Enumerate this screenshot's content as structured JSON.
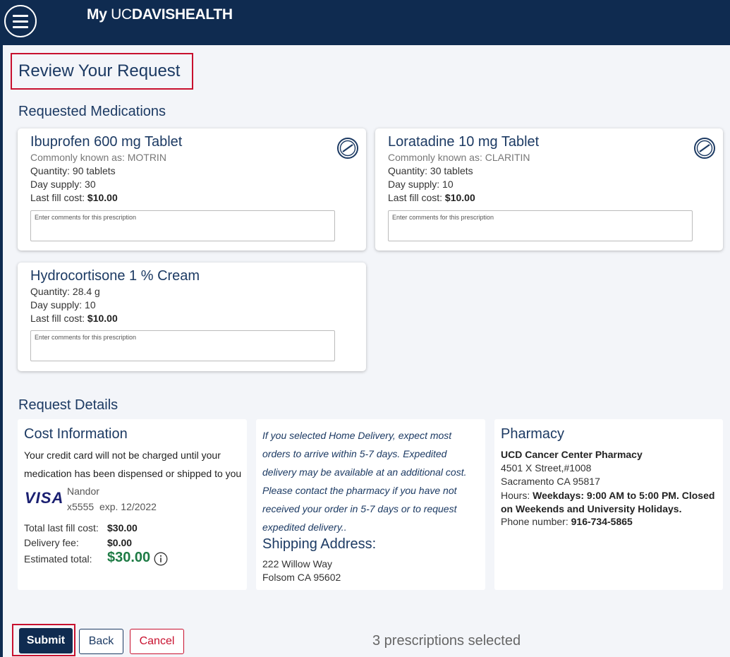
{
  "header": {
    "logo_part1": "My ",
    "logo_part2": "UC",
    "logo_part3": "DAVIS",
    "logo_part4": "HEALTH",
    "menu_icon": "hamburger-icon"
  },
  "page": {
    "title": "Review Your Request"
  },
  "medications_section": {
    "heading": "Requested Medications",
    "comment_placeholder": "Enter comments for this prescription",
    "items": [
      {
        "name": "Ibuprofen 600 mg Tablet",
        "known_as": "Commonly known as: MOTRIN",
        "quantity": "Quantity: 90 tablets",
        "day_supply": "Day supply: 30",
        "last_fill_label": "Last fill cost: ",
        "last_fill_value": "$10.00",
        "icon": "pill-icon"
      },
      {
        "name": "Loratadine 10 mg Tablet",
        "known_as": "Commonly known as: CLARITIN",
        "quantity": "Quantity: 30 tablets",
        "day_supply": "Day supply: 10",
        "last_fill_label": "Last fill cost: ",
        "last_fill_value": "$10.00",
        "icon": "pill-icon"
      },
      {
        "name": "Hydrocortisone 1 % Cream",
        "quantity": "Quantity: 28.4 g",
        "day_supply": "Day supply: 10",
        "last_fill_label": "Last fill cost: ",
        "last_fill_value": "$10.00"
      }
    ]
  },
  "request_details": {
    "heading": "Request Details",
    "cost": {
      "title": "Cost Information",
      "note": "Your credit card will not be charged until your medication has been dispensed or shipped to you",
      "card_brand": "VISA",
      "card_holder": "Nandor",
      "card_number": "x5555",
      "card_exp": "exp. 12/2022",
      "total_last_fill_label": "Total last fill cost:",
      "total_last_fill_value": "$30.00",
      "delivery_fee_label": "Delivery fee:",
      "delivery_fee_value": "$0.00",
      "estimated_total_label": "Estimated total:",
      "estimated_total_value": "$30.00",
      "info_icon": "info-icon"
    },
    "delivery": {
      "note": "If you selected Home Delivery, expect most orders to arrive within 5-7 days. Expedited delivery may be available at an additional cost. Please contact the pharmacy if you have not received your order in 5-7 days or to request expedited delivery..",
      "shipping_title": "Shipping Address:",
      "address_line1": "222 Willow Way",
      "address_line2": "Folsom CA 95602"
    },
    "pharmacy": {
      "title": "Pharmacy",
      "name": "UCD Cancer Center Pharmacy",
      "address_line1": "4501 X Street,#1008",
      "address_line2": "Sacramento CA 95817",
      "hours_label": "Hours: ",
      "hours_value": "Weekdays: 9:00 AM to 5:00 PM. Closed on Weekends and University Holidays.",
      "phone_label": "Phone number: ",
      "phone_value": "916-734-5865"
    }
  },
  "actions": {
    "submit_label": "Submit",
    "back_label": "Back",
    "cancel_label": "Cancel",
    "selected_count": "3 prescriptions selected"
  },
  "colors": {
    "header_bg": "#0f2b50",
    "heading_text": "#1c3a63",
    "highlight_border": "#c8102e",
    "total_green": "#1e7b45"
  }
}
